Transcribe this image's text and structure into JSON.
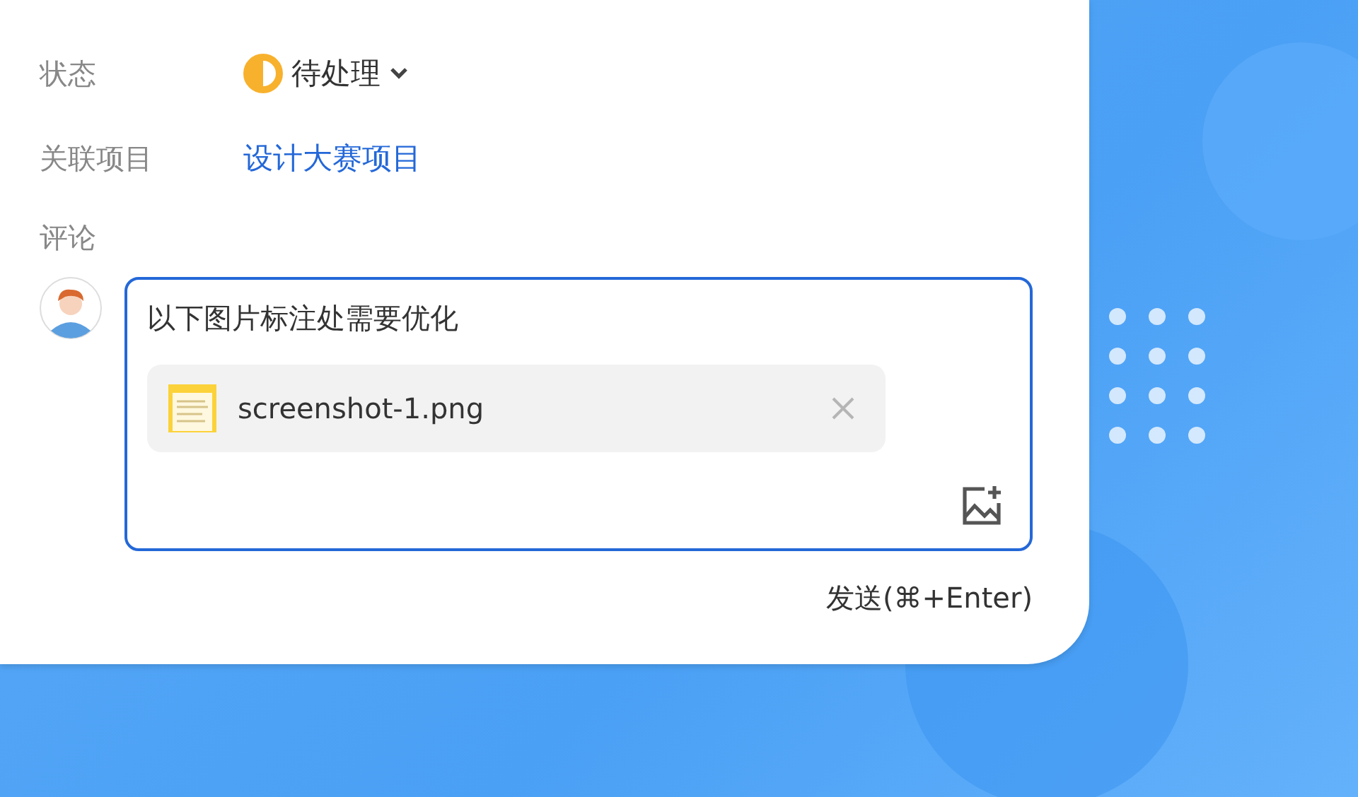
{
  "fields": [
    {
      "label": "状态",
      "kind": "status",
      "value": "待处理"
    },
    {
      "label": "关联项目",
      "kind": "link",
      "value": "设计大赛项目"
    }
  ],
  "comment": {
    "label": "评论",
    "value": "以下图片标注处需要优化",
    "attachments": [
      {
        "name": "screenshot-1.png"
      }
    ],
    "send": "发送(⌘+Enter)"
  }
}
